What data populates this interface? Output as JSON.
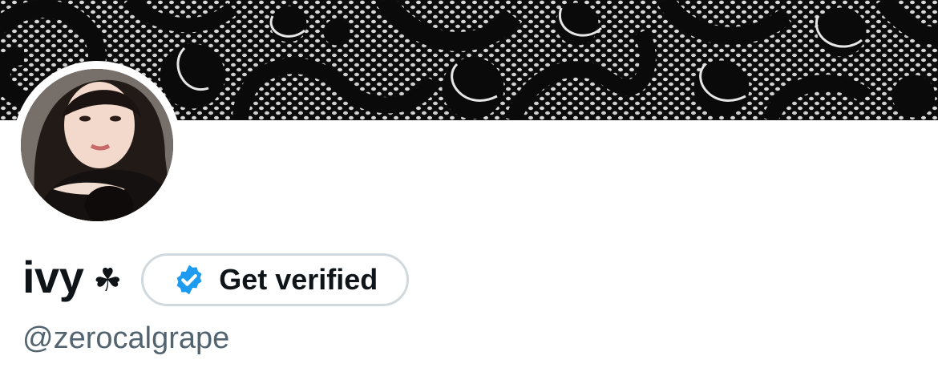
{
  "profile": {
    "display_name": "ivy",
    "name_emoji": "☘",
    "handle": "@zerocalgrape",
    "get_verified_label": "Get verified"
  },
  "icons": {
    "verified_badge": "verified-badge-icon",
    "name_emoji": "shamrock-icon"
  },
  "colors": {
    "text_primary": "#0f1419",
    "text_secondary": "#536471",
    "verified_blue": "#1d9bf0",
    "button_border": "#cfd9de",
    "banner_dark": "#0c0c0c"
  }
}
